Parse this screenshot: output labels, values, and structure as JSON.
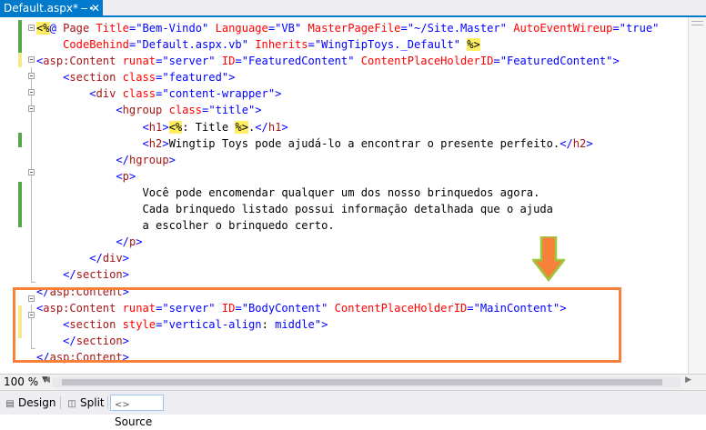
{
  "tab": {
    "title": "Default.aspx*",
    "pin_icon": "pin-icon",
    "close_icon": "close-icon"
  },
  "code_lines": [
    [
      {
        "c": "dlm",
        "t": "<%"
      },
      {
        "c": "pre",
        "t": "@"
      },
      {
        "c": "txt",
        "t": " "
      },
      {
        "c": "tag",
        "t": "Page"
      },
      {
        "c": "txt",
        "t": " "
      },
      {
        "c": "attr",
        "t": "Title"
      },
      {
        "c": "br",
        "t": "="
      },
      {
        "c": "val",
        "t": "\"Bem-Vindo\""
      },
      {
        "c": "txt",
        "t": " "
      },
      {
        "c": "attr",
        "t": "Language"
      },
      {
        "c": "br",
        "t": "="
      },
      {
        "c": "val",
        "t": "\"VB\""
      },
      {
        "c": "txt",
        "t": " "
      },
      {
        "c": "attr",
        "t": "MasterPageFile"
      },
      {
        "c": "br",
        "t": "="
      },
      {
        "c": "val",
        "t": "\"~/Site.Master\""
      },
      {
        "c": "txt",
        "t": " "
      },
      {
        "c": "attr",
        "t": "AutoEventWireup"
      },
      {
        "c": "br",
        "t": "="
      },
      {
        "c": "val",
        "t": "\"true\""
      }
    ],
    [
      {
        "c": "txt",
        "t": "    "
      },
      {
        "c": "attr",
        "t": "CodeBehind"
      },
      {
        "c": "br",
        "t": "="
      },
      {
        "c": "val",
        "t": "\"Default.aspx.vb\""
      },
      {
        "c": "txt",
        "t": " "
      },
      {
        "c": "attr",
        "t": "Inherits"
      },
      {
        "c": "br",
        "t": "="
      },
      {
        "c": "val",
        "t": "\"WingTipToys._Default\""
      },
      {
        "c": "txt",
        "t": " "
      },
      {
        "c": "dlm",
        "t": "%>"
      }
    ],
    [
      {
        "c": "br",
        "t": "<"
      },
      {
        "c": "tag",
        "t": "asp:Content"
      },
      {
        "c": "txt",
        "t": " "
      },
      {
        "c": "attr",
        "t": "runat"
      },
      {
        "c": "br",
        "t": "="
      },
      {
        "c": "val",
        "t": "\"server\""
      },
      {
        "c": "txt",
        "t": " "
      },
      {
        "c": "attr",
        "t": "ID"
      },
      {
        "c": "br",
        "t": "="
      },
      {
        "c": "val",
        "t": "\"FeaturedContent\""
      },
      {
        "c": "txt",
        "t": " "
      },
      {
        "c": "attr",
        "t": "ContentPlaceHolderID"
      },
      {
        "c": "br",
        "t": "="
      },
      {
        "c": "val",
        "t": "\"FeaturedContent\""
      },
      {
        "c": "br",
        "t": ">"
      }
    ],
    [
      {
        "c": "txt",
        "t": "    "
      },
      {
        "c": "br",
        "t": "<"
      },
      {
        "c": "tag",
        "t": "section"
      },
      {
        "c": "txt",
        "t": " "
      },
      {
        "c": "attr",
        "t": "class"
      },
      {
        "c": "br",
        "t": "="
      },
      {
        "c": "val",
        "t": "\"featured\""
      },
      {
        "c": "br",
        "t": ">"
      }
    ],
    [
      {
        "c": "txt",
        "t": "        "
      },
      {
        "c": "br",
        "t": "<"
      },
      {
        "c": "tag",
        "t": "div"
      },
      {
        "c": "txt",
        "t": " "
      },
      {
        "c": "attr",
        "t": "class"
      },
      {
        "c": "br",
        "t": "="
      },
      {
        "c": "val",
        "t": "\"content-wrapper\""
      },
      {
        "c": "br",
        "t": ">"
      }
    ],
    [
      {
        "c": "txt",
        "t": "            "
      },
      {
        "c": "br",
        "t": "<"
      },
      {
        "c": "tag",
        "t": "hgroup"
      },
      {
        "c": "txt",
        "t": " "
      },
      {
        "c": "attr",
        "t": "class"
      },
      {
        "c": "br",
        "t": "="
      },
      {
        "c": "val",
        "t": "\"title\""
      },
      {
        "c": "br",
        "t": ">"
      }
    ],
    [
      {
        "c": "txt",
        "t": "                "
      },
      {
        "c": "br",
        "t": "<"
      },
      {
        "c": "tag",
        "t": "h1"
      },
      {
        "c": "br",
        "t": ">"
      },
      {
        "c": "dlm",
        "t": "<%"
      },
      {
        "c": "txt",
        "t": ": Title "
      },
      {
        "c": "dlm",
        "t": "%>"
      },
      {
        "c": "txt",
        "t": "."
      },
      {
        "c": "br",
        "t": "</"
      },
      {
        "c": "tag",
        "t": "h1"
      },
      {
        "c": "br",
        "t": ">"
      }
    ],
    [
      {
        "c": "txt",
        "t": "                "
      },
      {
        "c": "br",
        "t": "<"
      },
      {
        "c": "tag",
        "t": "h2"
      },
      {
        "c": "br",
        "t": ">"
      },
      {
        "c": "txt",
        "t": "Wingtip Toys pode ajudá-lo a encontrar o presente perfeito."
      },
      {
        "c": "br",
        "t": "</"
      },
      {
        "c": "tag",
        "t": "h2"
      },
      {
        "c": "br",
        "t": ">"
      }
    ],
    [
      {
        "c": "txt",
        "t": "            "
      },
      {
        "c": "br",
        "t": "</"
      },
      {
        "c": "tag",
        "t": "hgroup"
      },
      {
        "c": "br",
        "t": ">"
      }
    ],
    [
      {
        "c": "txt",
        "t": "            "
      },
      {
        "c": "br",
        "t": "<"
      },
      {
        "c": "tag",
        "t": "p"
      },
      {
        "c": "br",
        "t": ">"
      }
    ],
    [
      {
        "c": "txt",
        "t": "                Você pode encomendar qualquer um dos nosso brinquedos agora."
      }
    ],
    [
      {
        "c": "txt",
        "t": "                Cada brinquedo listado possui informação detalhada que o ajuda"
      }
    ],
    [
      {
        "c": "txt",
        "t": "                a escolher o brinquedo certo."
      }
    ],
    [
      {
        "c": "txt",
        "t": "            "
      },
      {
        "c": "br",
        "t": "</"
      },
      {
        "c": "tag",
        "t": "p"
      },
      {
        "c": "br",
        "t": ">"
      }
    ],
    [
      {
        "c": "txt",
        "t": "        "
      },
      {
        "c": "br",
        "t": "</"
      },
      {
        "c": "tag",
        "t": "div"
      },
      {
        "c": "br",
        "t": ">"
      }
    ],
    [
      {
        "c": "txt",
        "t": "    "
      },
      {
        "c": "br",
        "t": "</"
      },
      {
        "c": "tag",
        "t": "section"
      },
      {
        "c": "br",
        "t": ">"
      }
    ],
    [
      {
        "c": "br",
        "t": "</"
      },
      {
        "c": "tag",
        "t": "asp:Content"
      },
      {
        "c": "br",
        "t": ">"
      }
    ],
    [
      {
        "c": "br",
        "t": "<"
      },
      {
        "c": "tag",
        "t": "asp:Content"
      },
      {
        "c": "txt",
        "t": " "
      },
      {
        "c": "attr",
        "t": "runat"
      },
      {
        "c": "br",
        "t": "="
      },
      {
        "c": "val",
        "t": "\"server\""
      },
      {
        "c": "txt",
        "t": " "
      },
      {
        "c": "attr",
        "t": "ID"
      },
      {
        "c": "br",
        "t": "="
      },
      {
        "c": "val",
        "t": "\"BodyContent\""
      },
      {
        "c": "txt",
        "t": " "
      },
      {
        "c": "attr",
        "t": "ContentPlaceHolderID"
      },
      {
        "c": "br",
        "t": "="
      },
      {
        "c": "val",
        "t": "\"MainContent\""
      },
      {
        "c": "br",
        "t": ">"
      }
    ],
    [
      {
        "c": "txt",
        "t": "    "
      },
      {
        "c": "br",
        "t": "<"
      },
      {
        "c": "tag",
        "t": "section"
      },
      {
        "c": "txt",
        "t": " "
      },
      {
        "c": "attr",
        "t": "style"
      },
      {
        "c": "br",
        "t": "="
      },
      {
        "c": "val",
        "t": "\"vertical-align"
      },
      {
        "c": "txt",
        "t": ": "
      },
      {
        "c": "val",
        "t": "middle\""
      },
      {
        "c": "br",
        "t": ">"
      }
    ],
    [
      {
        "c": "txt",
        "t": "    "
      },
      {
        "c": "br",
        "t": "</"
      },
      {
        "c": "tag",
        "t": "section"
      },
      {
        "c": "br",
        "t": ">"
      }
    ],
    [
      {
        "c": "br",
        "t": "</"
      },
      {
        "c": "tag",
        "t": "asp:Content"
      },
      {
        "c": "br",
        "t": ">"
      }
    ]
  ],
  "colors": {
    "tag": "#a31515",
    "bracket": "#0000ff",
    "attribute": "#ff0000",
    "value": "#0000ff",
    "delimiter_bg": "#ffee62",
    "changed_saved": "#57a64a",
    "changed_unsaved": "#f6e98b",
    "callout": "#f7813b",
    "tab_active": "#007acc"
  },
  "zoom": {
    "value": "100 %"
  },
  "view_buttons": [
    {
      "label": "Design",
      "icon": "design-icon",
      "active": false
    },
    {
      "label": "Split",
      "icon": "split-icon",
      "active": false
    },
    {
      "label": "Source",
      "icon": "source-icon",
      "active": true
    }
  ]
}
